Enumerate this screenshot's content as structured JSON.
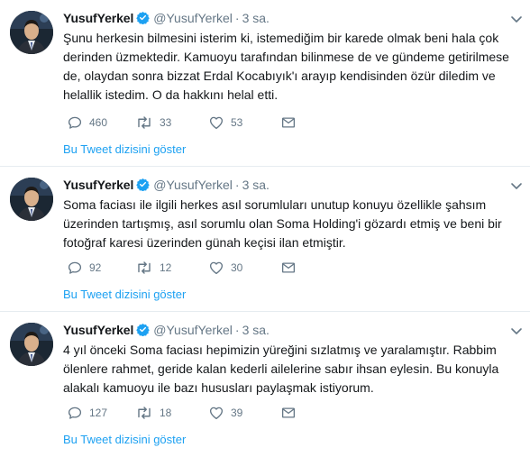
{
  "tweets": [
    {
      "author_name": "YusufYerkel",
      "handle": "@YusufYerkel",
      "separator": "·",
      "time": "3 sa.",
      "text_lines": [
        "Şunu herkesin bilmesini isterim ki, istemediğim bir karede olmak beni hala çok",
        "derinden üzmektedir. Kamuoyu tarafından bilinmese de ve gündeme getirilmese",
        "de, olaydan sonra bizzat Erdal Kocabıyık'ı arayıp kendisinden özür diledim ve",
        "helallik istedim. O da hakkını helal etti."
      ],
      "reply_count": "460",
      "retweet_count": "33",
      "like_count": "53",
      "thread_link": "Bu Tweet dizisini göster"
    },
    {
      "author_name": "YusufYerkel",
      "handle": "@YusufYerkel",
      "separator": "·",
      "time": "3 sa.",
      "text_lines": [
        "Soma faciası ile ilgili herkes asıl sorumluları unutup konuyu özellikle şahsım",
        "üzerinden tartışmış, asıl sorumlu olan Soma Holding'i gözardı etmiş ve beni bir",
        "fotoğraf karesi üzerinden günah keçisi ilan etmiştir."
      ],
      "reply_count": "92",
      "retweet_count": "12",
      "like_count": "30",
      "thread_link": "Bu Tweet dizisini göster"
    },
    {
      "author_name": "YusufYerkel",
      "handle": "@YusufYerkel",
      "separator": "·",
      "time": "3 sa.",
      "text_lines": [
        "4 yıl önceki Soma faciası hepimizin yüreğini sızlatmış ve yaralamıştır. Rabbim",
        "ölenlere rahmet, geride kalan kederli ailelerine sabır ihsan eylesin. Bu konuyla",
        "alakalı kamuoyu ile bazı hususları paylaşmak istiyorum."
      ],
      "reply_count": "127",
      "retweet_count": "18",
      "like_count": "39",
      "thread_link": "Bu Tweet dizisini göster"
    }
  ],
  "icons": {
    "verified": "verified-badge-icon",
    "reply": "reply-icon",
    "retweet": "retweet-icon",
    "like": "heart-icon",
    "message": "direct-message-icon",
    "menu": "chevron-down-icon"
  },
  "colors": {
    "link": "#1da1f2",
    "secondary_text": "#657786",
    "divider": "#e6ecf0",
    "verified": "#1da1f2"
  }
}
